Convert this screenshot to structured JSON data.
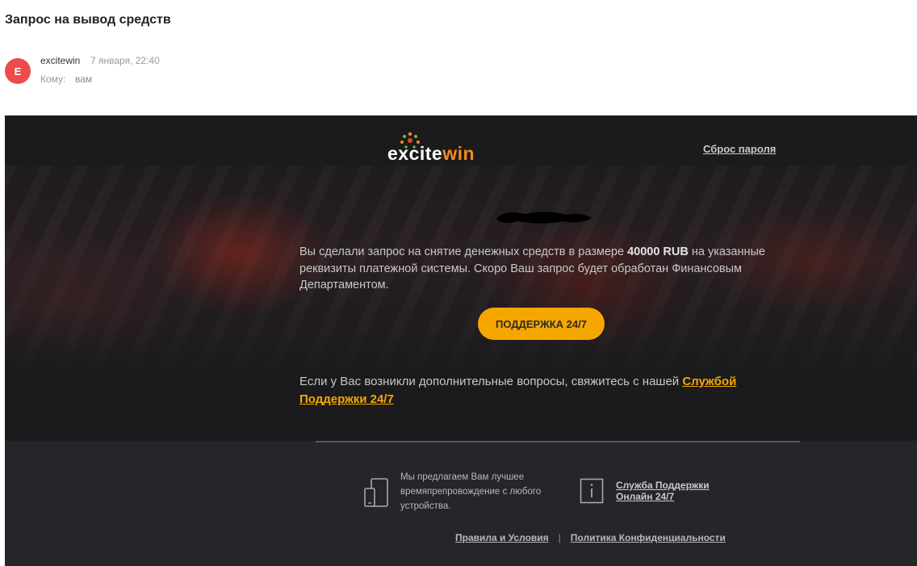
{
  "email": {
    "subject": "Запрос на вывод средств",
    "avatar_letter": "E",
    "sender_name": "excitewin",
    "date": "7 января, 22:40",
    "to_label": "Кому:",
    "to_value": "вам"
  },
  "mail": {
    "logo": {
      "part_a": "exc",
      "part_b": "ite",
      "part_c": "win",
      "accent": "#f5891e"
    },
    "reset_link": "Сброс пароля",
    "message_before": "Вы сделали запрос на снятие денежных средств в размере ",
    "amount": "40000 RUB",
    "message_after": " на указанные реквизиты платежной системы. Скоро Ваш запрос будет обработан Финансовым Департаментом.",
    "support_button": "ПОДДЕРЖКА 24/7",
    "questions_text": "Если у Вас возникли дополнительные вопросы, свяжитесь с нашей ",
    "questions_link": "Службой Поддержки 24/7",
    "accent_color": "#f5a700"
  },
  "footer": {
    "device_text": "Мы предлагаем Вам лучшее времяпрепровождение с любого устройства.",
    "support_link": "Служба Поддержки Онлайн 24/7",
    "terms_link": "Правила и Условия",
    "separator": "|",
    "privacy_link": "Политика Конфиденциальности",
    "icons": [
      "device-icon",
      "info-icon"
    ]
  }
}
